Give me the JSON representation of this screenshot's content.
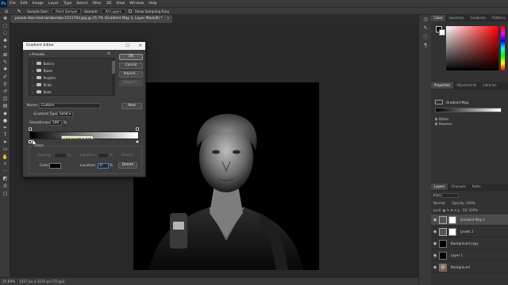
{
  "app": {
    "logo": "Ps"
  },
  "menubar": {
    "items": [
      "File",
      "Edit",
      "Image",
      "Layer",
      "Type",
      "Select",
      "Filter",
      "3D",
      "View",
      "Window",
      "Help"
    ]
  },
  "options": {
    "sample_size_label": "Sample Size:",
    "sample_size_value": "Point Sample",
    "sample_label": "Sample:",
    "sample_value": "All Layers",
    "show_ring_label": "Show Sampling Ring"
  },
  "document": {
    "tab_title": "pexels-stas-shot-lambombo-1511793.jpg @ 25.7% (Gradient Map 1, Layer Mask/8) *",
    "zoom": "25.69%",
    "status": "2117 px x 2115 px (72 ppi)"
  },
  "gradient_editor": {
    "title": "Gradient Editor",
    "presets_label": "Presets",
    "presets": [
      "Basics",
      "Blues",
      "Purples",
      "Pinks",
      "Reds"
    ],
    "buttons": {
      "ok": "OK",
      "cancel": "Cancel",
      "import": "Import...",
      "export": "Export...",
      "new": "New"
    },
    "name_label": "Name:",
    "name_value": "Custom",
    "type_label": "Gradient Type:",
    "type_value": "Solid",
    "smoothness_label": "Smoothness:",
    "smoothness_value": "100",
    "smoothness_unit": "%",
    "tooltip": "Click to add a stop",
    "stops": {
      "title": "Stops",
      "opacity_label": "Opacity:",
      "opacity_unit": "%",
      "location_label": "Location:",
      "location_unit": "%",
      "delete_label": "Delete",
      "color_label": "Color:",
      "color_location_value": "0",
      "color_location_unit": "%"
    }
  },
  "panels": {
    "color_tabs": [
      "Color",
      "Swatches",
      "Gradients",
      "Patterns"
    ],
    "properties_tabs": [
      "Properties",
      "Adjustments",
      "Libraries"
    ],
    "properties": {
      "title": "Gradient Map",
      "dither_label": "Dither",
      "reverse_label": "Reverse"
    },
    "layers_tabs": [
      "Layers",
      "Channels",
      "Paths"
    ],
    "layers_controls": {
      "kind": "Kind",
      "mode": "Normal",
      "opacity_label": "Opacity:",
      "opacity_value": "100%",
      "lock_label": "Lock:",
      "fill_label": "Fill:",
      "fill_value": "100%"
    },
    "layers": [
      {
        "name": "Gradient Map 1",
        "thumb": "adj"
      },
      {
        "name": "Levels 1",
        "thumb": "white"
      },
      {
        "name": "Background copy",
        "thumb": "black"
      },
      {
        "name": "Layer 1",
        "thumb": "black"
      },
      {
        "name": "Background",
        "thumb": "photo"
      }
    ]
  }
}
